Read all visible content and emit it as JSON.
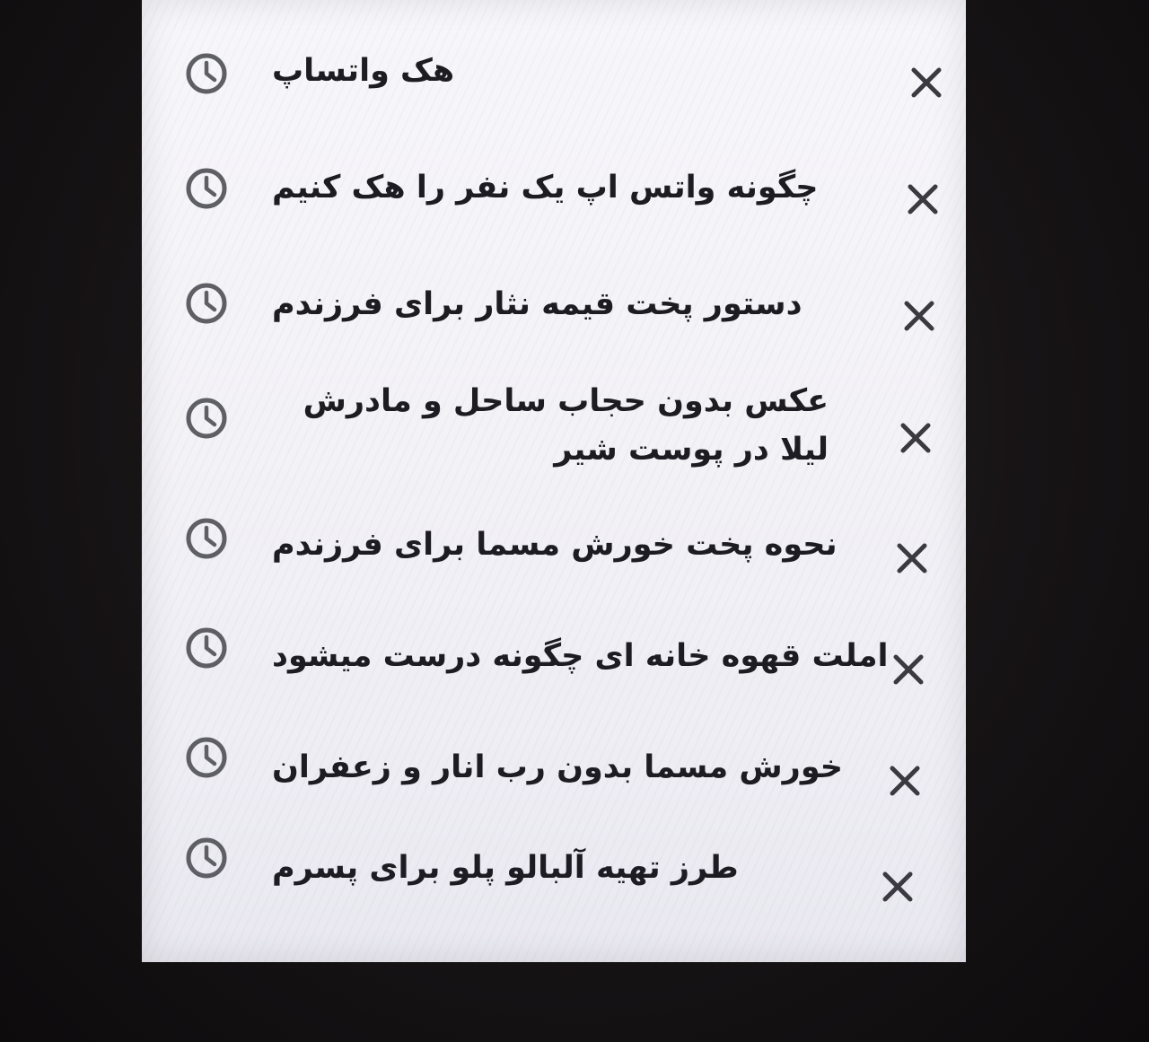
{
  "history": {
    "items": [
      {
        "query": "هک واتساپ",
        "clock_icon": "clock-history-icon",
        "remove_icon": "close-x-icon"
      },
      {
        "query": "چگونه واتس اپ یک نفر را هک کنیم",
        "clock_icon": "clock-history-icon",
        "remove_icon": "close-x-icon"
      },
      {
        "query": "دستور پخت قیمه نثار برای فرزندم",
        "clock_icon": "clock-history-icon",
        "remove_icon": "close-x-icon"
      },
      {
        "query": "عکس بدون حجاب ساحل و مادرش لیلا در پوست شیر",
        "clock_icon": "clock-history-icon",
        "remove_icon": "close-x-icon"
      },
      {
        "query": "نحوه پخت خورش مسما برای فرزندم",
        "clock_icon": "clock-history-icon",
        "remove_icon": "close-x-icon"
      },
      {
        "query": "املت قهوه خانه ای چگونه درست میشود",
        "clock_icon": "clock-history-icon",
        "remove_icon": "close-x-icon"
      },
      {
        "query": "خورش مسما بدون رب انار و زعفران",
        "clock_icon": "clock-history-icon",
        "remove_icon": "close-x-icon"
      },
      {
        "query": "طرز تهیه آلبالو پلو برای پسرم",
        "clock_icon": "clock-history-icon",
        "remove_icon": "close-x-icon"
      }
    ]
  },
  "colors": {
    "screen_background": "#f3f2f7",
    "text": "#1c1c22",
    "icon": "#5f5f66",
    "bezel": "#151314"
  }
}
